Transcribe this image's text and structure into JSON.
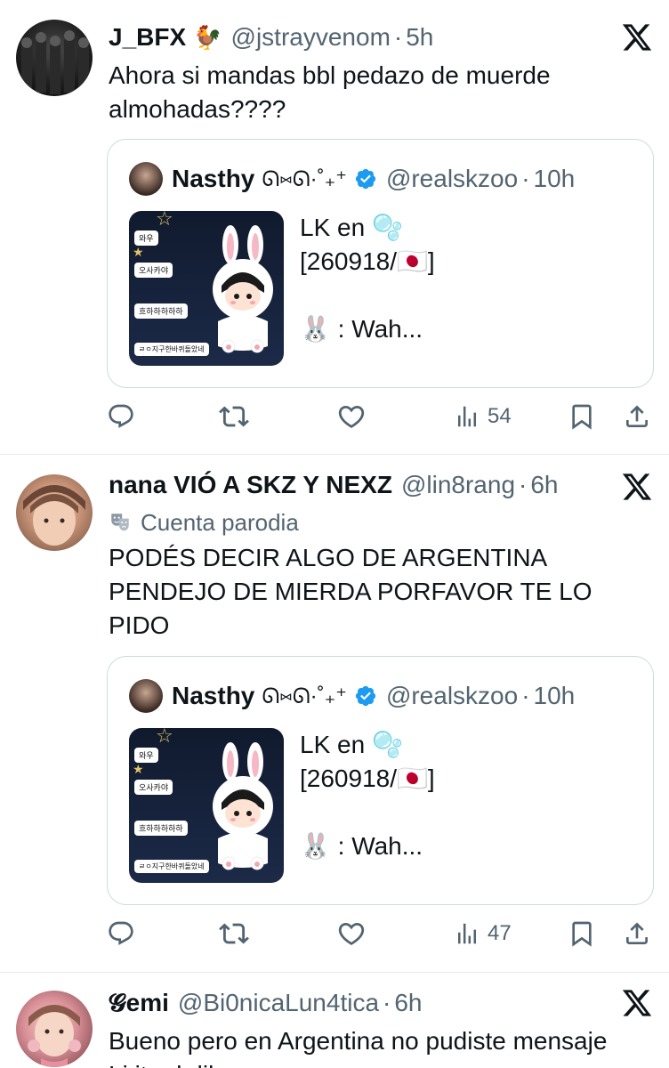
{
  "tweets": [
    {
      "name": "J_BFX",
      "emoji": "🐓",
      "handle": "@jstrayvenom",
      "time": "5h",
      "text_lines": [
        "Ahora si mandas bbl pedazo de muerde",
        "almohadas????"
      ],
      "quote": {
        "name": "Nasthy",
        "kaomoji": "ᘏ⑅ᘏ·˚₊⁺",
        "handle": "@realskzoo",
        "time": "10h",
        "text_lines": [
          "LK en 🫧",
          "[260918/🇯🇵]",
          "",
          "🐰 : Wah..."
        ],
        "chat_bubbles": [
          "와우",
          "오사카야",
          "흐하하하하하",
          "ㄹㅇ지구한바퀴돌았네"
        ]
      },
      "views": "54"
    },
    {
      "name": "nana VIÓ A SKZ Y NEXZ",
      "handle": "@lin8rang",
      "time": "6h",
      "parody_label": "Cuenta parodia",
      "text_lines": [
        "PODÉS DECIR ALGO DE ARGENTINA",
        "PENDEJO DE MIERDA PORFAVOR TE LO",
        "PIDO"
      ],
      "quote": {
        "name": "Nasthy",
        "kaomoji": "ᘏ⑅ᘏ·˚₊⁺",
        "handle": "@realskzoo",
        "time": "10h",
        "text_lines": [
          "LK en 🫧",
          "[260918/🇯🇵]",
          "",
          "🐰 : Wah..."
        ],
        "chat_bubbles": [
          "와우",
          "오사카야",
          "흐하하하하하",
          "ㄹㅇ지구한바퀴돌았네"
        ]
      },
      "views": "47"
    },
    {
      "name": "𝓖emi",
      "handle": "@Bi0nicaLun4tica",
      "time": "6h",
      "text_lines": [
        "Bueno pero en Argentina no pudiste mensaje",
        "Li ita  d              dil  "
      ]
    }
  ],
  "colors": {
    "text": "#0f1419",
    "secondary": "#536471",
    "border": "#cfd9de",
    "verified": "#1d9bf0"
  },
  "icons": [
    "x-logo-icon",
    "reply-icon",
    "retweet-icon",
    "like-icon",
    "views-icon",
    "bookmark-icon",
    "share-icon",
    "verified-badge-icon",
    "parody-mask-icon"
  ]
}
